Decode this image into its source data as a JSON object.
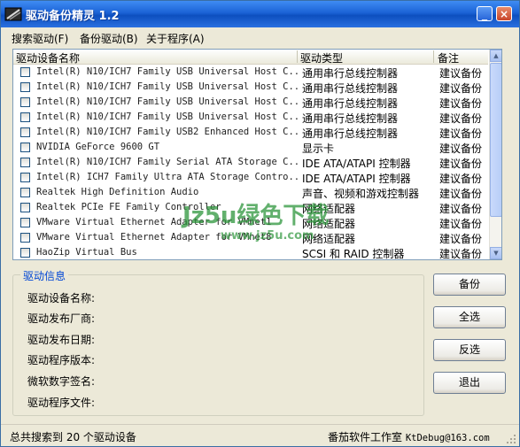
{
  "window": {
    "title": "驱动备份精灵 1.2",
    "minimize_glyph": "_",
    "close_glyph": "×",
    "title_color": "#1b62d6"
  },
  "menu": [
    {
      "label": "搜索驱动(F)"
    },
    {
      "label": "备份驱动(B)"
    },
    {
      "label": "关于程序(A)"
    }
  ],
  "table": {
    "columns": [
      "驱动设备名称",
      "驱动类型",
      "备注"
    ],
    "rows": [
      {
        "name": "Intel(R) N10/ICH7 Family USB Universal Host C...",
        "type": "通用串行总线控制器",
        "note": "建议备份"
      },
      {
        "name": "Intel(R) N10/ICH7 Family USB Universal Host C...",
        "type": "通用串行总线控制器",
        "note": "建议备份"
      },
      {
        "name": "Intel(R) N10/ICH7 Family USB Universal Host C...",
        "type": "通用串行总线控制器",
        "note": "建议备份"
      },
      {
        "name": "Intel(R) N10/ICH7 Family USB Universal Host C...",
        "type": "通用串行总线控制器",
        "note": "建议备份"
      },
      {
        "name": "Intel(R) N10/ICH7 Family USB2 Enhanced Host C...",
        "type": "通用串行总线控制器",
        "note": "建议备份"
      },
      {
        "name": "NVIDIA GeForce 9600 GT",
        "type": "显示卡",
        "note": "建议备份"
      },
      {
        "name": "Intel(R) N10/ICH7 Family Serial ATA Storage C...",
        "type": "IDE ATA/ATAPI 控制器",
        "note": "建议备份"
      },
      {
        "name": "Intel(R) ICH7 Family Ultra ATA Storage Contro...",
        "type": "IDE ATA/ATAPI 控制器",
        "note": "建议备份"
      },
      {
        "name": "Realtek High Definition Audio",
        "type": "声音、视频和游戏控制器",
        "note": "建议备份"
      },
      {
        "name": "Realtek PCIe FE Family Controller",
        "type": "网络适配器",
        "note": "建议备份"
      },
      {
        "name": "VMware Virtual Ethernet Adapter for VMnet1",
        "type": "网络适配器",
        "note": "建议备份"
      },
      {
        "name": "VMware Virtual Ethernet Adapter for VMnet8",
        "type": "网络适配器",
        "note": "建议备份"
      },
      {
        "name": "HaoZip Virtual Bus",
        "type": "SCSI 和 RAID 控制器",
        "note": "建议备份"
      }
    ]
  },
  "info": {
    "legend": "驱动信息",
    "labels": [
      "驱动设备名称:",
      "驱动发布厂商:",
      "驱动发布日期:",
      "驱动程序版本:",
      "微软数字签名:",
      "驱动程序文件:"
    ]
  },
  "buttons": {
    "backup": "备份",
    "select_all": "全选",
    "invert": "反选",
    "exit": "退出"
  },
  "status": {
    "left": "总共搜索到 20 个驱动设备",
    "studio": "番茄软件工作室",
    "email": "KtDebug@163.com"
  },
  "watermark": {
    "main": "Jz5u绿色下载",
    "sub": "www.jz5u.com"
  }
}
